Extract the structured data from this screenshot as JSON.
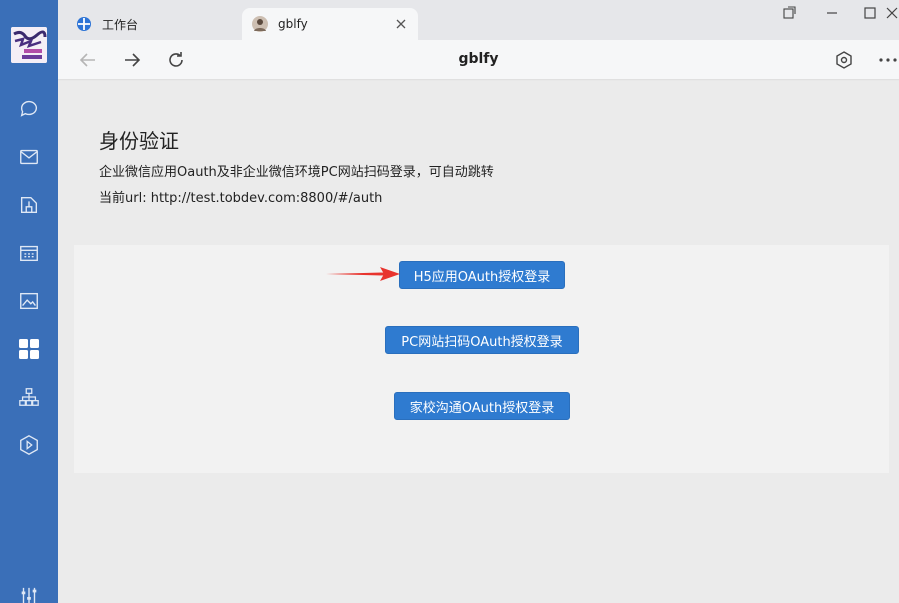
{
  "tabs": [
    {
      "label": "工作台",
      "icon": "workbench-icon"
    },
    {
      "label": "gblfy",
      "icon": "avatar-icon"
    }
  ],
  "toolbar": {
    "title": "gblfy"
  },
  "page": {
    "heading": "身份验证",
    "description": "企业微信应用Oauth及非企业微信环境PC网站扫码登录，可自动跳转",
    "url_line": "当前url: http://test.tobdev.com:8800/#/auth"
  },
  "buttons": {
    "h5": "H5应用OAuth授权登录",
    "pc": "PC网站扫码OAuth授权登录",
    "school": "家校沟通OAuth授权登录"
  },
  "sidebar": {
    "items": [
      "chat-icon",
      "mail-icon",
      "docs-icon",
      "calendar-icon",
      "photo-icon",
      "apps-icon",
      "org-icon",
      "miniapp-icon",
      "settings-icon"
    ]
  },
  "colors": {
    "sidebar": "#3a6fb8",
    "button": "#2f7bd0",
    "arrow": "#e8342e"
  }
}
